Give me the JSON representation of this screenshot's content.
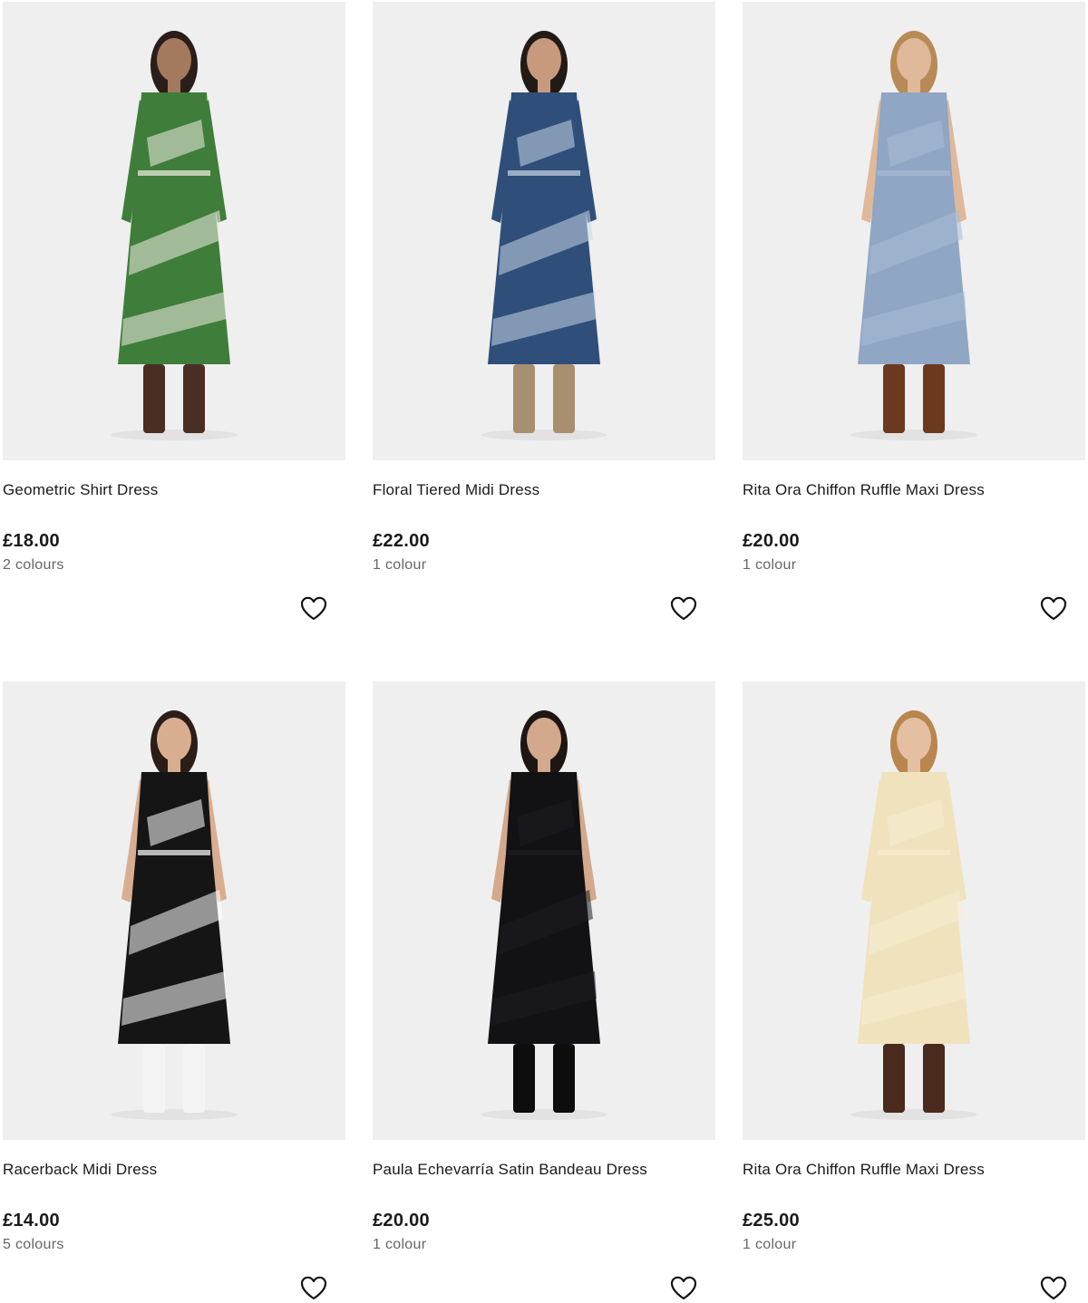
{
  "products": [
    {
      "title": "Geometric Shirt Dress",
      "price": "£18.00",
      "colours": "2 colours",
      "image_icon": "model-green-geometric-dress-image",
      "colors": {
        "bg": "#efefef",
        "dress": "#3f7d3a",
        "accent": "#f2efe6",
        "boots": "#4a2e24",
        "skin": "#a5795e",
        "hair": "#2a1e1a"
      }
    },
    {
      "title": "Floral Tiered Midi Dress",
      "price": "£22.00",
      "colours": "1 colour",
      "image_icon": "model-blue-floral-dress-image",
      "colors": {
        "bg": "#efefef",
        "dress": "#2f4f7a",
        "accent": "#c9d6e6",
        "boots": "#a88f70",
        "skin": "#c79a7e",
        "hair": "#231a16"
      }
    },
    {
      "title": "Rita Ora Chiffon Ruffle Maxi Dress",
      "price": "£20.00",
      "colours": "1 colour",
      "image_icon": "model-blue-chiffon-dress-image",
      "colors": {
        "bg": "#efefef",
        "dress": "#8fa6c4",
        "accent": "#a9bbd4",
        "boots": "#6b3a1e",
        "skin": "#e0b89a",
        "hair": "#b88a55"
      }
    },
    {
      "title": "Racerback Midi Dress",
      "price": "£14.00",
      "colours": "5 colours",
      "image_icon": "model-black-racerback-dress-image",
      "colors": {
        "bg": "#efefef",
        "dress": "#151515",
        "accent": "#ffffff",
        "boots": "#f4f4f4",
        "skin": "#d9ae90",
        "hair": "#2b1e18"
      }
    },
    {
      "title": "Paula Echevarría Satin Bandeau Dress",
      "price": "£20.00",
      "colours": "1 colour",
      "image_icon": "model-black-satin-dress-image",
      "colors": {
        "bg": "#efefef",
        "dress": "#121214",
        "accent": "#1c1c22",
        "boots": "#0d0d0d",
        "skin": "#d3a88c",
        "hair": "#1e1614"
      }
    },
    {
      "title": "Rita Ora Chiffon Ruffle Maxi Dress",
      "price": "£25.00",
      "colours": "1 colour",
      "image_icon": "model-cream-chiffon-dress-image",
      "colors": {
        "bg": "#efefef",
        "dress": "#efe2bd",
        "accent": "#f6ecd2",
        "boots": "#4a2a1c",
        "skin": "#e4bfa2",
        "hair": "#b8864e"
      }
    }
  ],
  "wishlist_icon": "heart-outline-icon"
}
